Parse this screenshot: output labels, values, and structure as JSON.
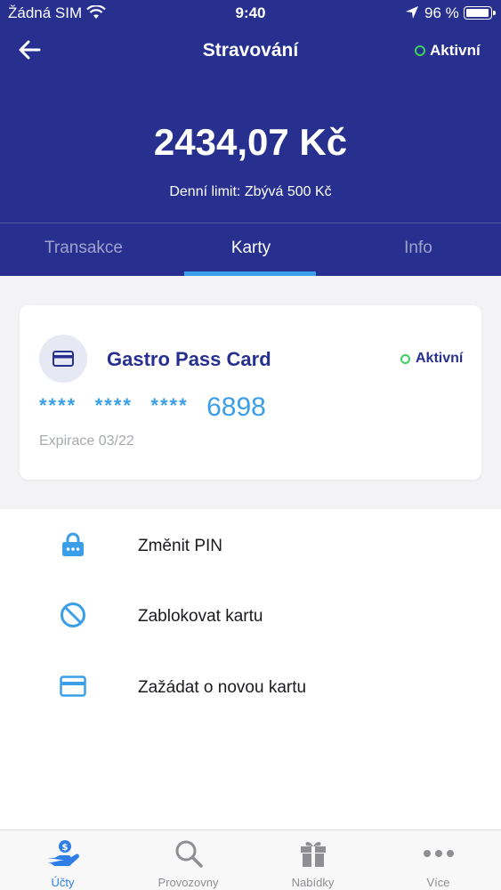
{
  "status_bar": {
    "carrier": "Žádná SIM",
    "time": "9:40",
    "battery": "96 %"
  },
  "header": {
    "title": "Stravování",
    "status": "Aktivní",
    "balance": "2434,07 Kč",
    "daily_limit": "Denní limit: Zbývá 500 Kč"
  },
  "tabs": [
    {
      "label": "Transakce",
      "active": false
    },
    {
      "label": "Karty",
      "active": true
    },
    {
      "label": "Info",
      "active": false
    }
  ],
  "card": {
    "name": "Gastro Pass Card",
    "status": "Aktivní",
    "number_masked": [
      "****",
      "****",
      "****"
    ],
    "number_last": "6898",
    "expiry": "Expirace 03/22"
  },
  "actions": [
    {
      "label": "Změnit PIN",
      "icon": "lock-icon"
    },
    {
      "label": "Zablokovat kartu",
      "icon": "block-icon"
    },
    {
      "label": "Zažádat o novou kartu",
      "icon": "card-icon"
    }
  ],
  "bottom_nav": [
    {
      "label": "Účty",
      "icon": "accounts-icon",
      "active": true
    },
    {
      "label": "Provozovny",
      "icon": "search-icon",
      "active": false
    },
    {
      "label": "Nabídky",
      "icon": "gift-icon",
      "active": false
    },
    {
      "label": "Více",
      "icon": "more-icon",
      "active": false
    }
  ],
  "colors": {
    "header_bg": "#27308f",
    "accent_blue": "#3a9fe8",
    "active_green": "#3ecf5e",
    "nav_active": "#2f7ee6"
  }
}
